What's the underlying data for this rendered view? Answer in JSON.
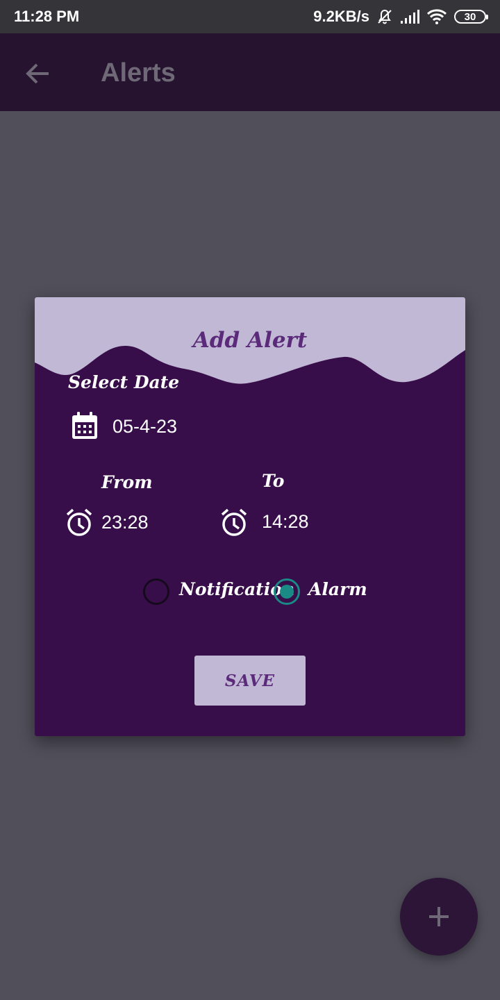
{
  "status_bar": {
    "time": "11:28 PM",
    "network_speed": "9.2KB/s",
    "battery_level": "30",
    "icons": [
      "bell-off-icon",
      "signal-icon",
      "wifi-icon",
      "battery-icon"
    ]
  },
  "app_bar": {
    "title": "Alerts",
    "back_icon": "arrow-back-icon"
  },
  "dialog": {
    "title": "Add Alert",
    "select_date_label": "Select Date",
    "date_value": "05-4-23",
    "from_label": "From",
    "from_time": "23:28",
    "to_label": "To",
    "to_time": "14:28",
    "options": [
      {
        "label": "Notification",
        "checked": false
      },
      {
        "label": "Alarm",
        "checked": true
      }
    ],
    "save_label": "SAVE"
  },
  "fab": {
    "icon": "plus-icon"
  },
  "colors": {
    "primary_dark": "#25132f",
    "dialog_background": "#380e4a",
    "header_light": "#c0b8d4",
    "accent_teal": "#1a8a86",
    "title_purple": "#5b2a7a"
  }
}
